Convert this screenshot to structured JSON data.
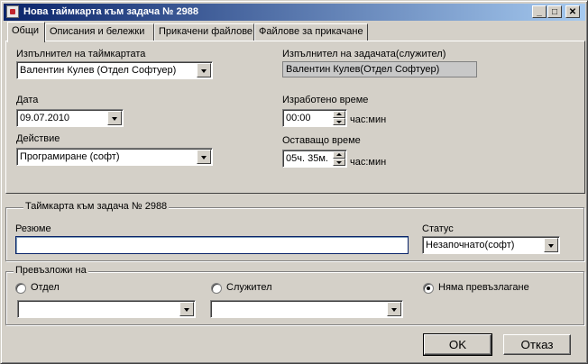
{
  "window": {
    "title": "Нова таймкарта към задача № 2988",
    "minimize_label": "_",
    "maximize_label": "□",
    "close_label": "✕"
  },
  "tabs": [
    {
      "label": "Общи",
      "active": true
    },
    {
      "label": "Описания и бележки",
      "active": false
    },
    {
      "label": "Прикачени файлове",
      "active": false
    },
    {
      "label": "Файлове за прикачане",
      "active": false
    }
  ],
  "general": {
    "performer_label": "Изпълнител на таймкартата",
    "performer_value": "Валентин Кулев (Отдел Софтуер)",
    "task_performer_label": "Изпълнител на задачата(служител)",
    "task_performer_value": "Валентин Кулев(Отдел Софтуер)",
    "date_label": "Дата",
    "date_value": "09.07.2010",
    "worked_label": "Изработено време",
    "worked_value": "00:00",
    "worked_unit": "час:мин",
    "action_label": "Действие",
    "action_value": "Програмиране (софт)",
    "remaining_label": "Оставащо време",
    "remaining_value": "05ч.  35м.",
    "remaining_unit": "час:мин"
  },
  "timecard_group": {
    "title": "Таймкарта към задача № 2988",
    "summary_label": "Резюме",
    "summary_value": "",
    "status_label": "Статус",
    "status_value": "Незапочнато(софт)"
  },
  "reassign_group": {
    "title": "Превъзложи на",
    "department_label": "Отдел",
    "employee_label": "Служител",
    "no_reassign_label": "Няма превъзлагане",
    "department_value": "",
    "employee_value": "",
    "selected": "no_reassign"
  },
  "buttons": {
    "ok_label": "OK",
    "cancel_label": "Отказ"
  }
}
